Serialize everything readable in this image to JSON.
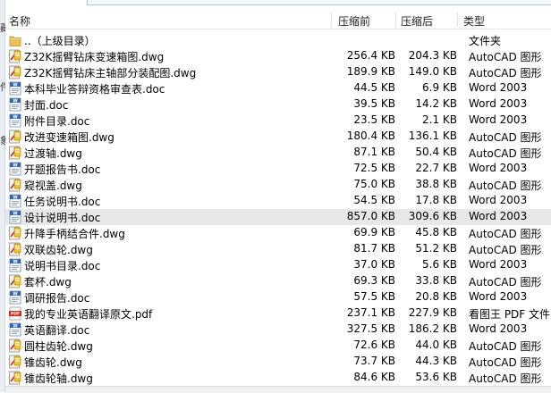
{
  "left_pane": {
    "fragments": [
      "藏",
      "件",
      "象"
    ]
  },
  "header": {
    "name": "名称",
    "compressed": "压缩前",
    "after": "压缩后",
    "type": "类型"
  },
  "files": [
    {
      "name": "..（上级目录）",
      "size": "",
      "packed": "",
      "type": "文件夹",
      "icon": "folder-up-icon"
    },
    {
      "name": "Z32K摇臂钻床变速箱图.dwg",
      "size": "256.4 KB",
      "packed": "204.3 KB",
      "type": "AutoCAD 图形",
      "icon": "dwg-file-icon"
    },
    {
      "name": "Z32K摇臂钻床主轴部分装配图.dwg",
      "size": "189.9 KB",
      "packed": "149.0 KB",
      "type": "AutoCAD 图形",
      "icon": "dwg-file-icon"
    },
    {
      "name": "本科毕业答辩资格审查表.doc",
      "size": "44.5 KB",
      "packed": "6.9 KB",
      "type": "Word 2003",
      "icon": "word-file-icon"
    },
    {
      "name": "封面.doc",
      "size": "39.5 KB",
      "packed": "14.2 KB",
      "type": "Word 2003",
      "icon": "word-file-icon"
    },
    {
      "name": "附件目录.doc",
      "size": "23.5 KB",
      "packed": "2.1 KB",
      "type": "Word 2003",
      "icon": "word-file-icon"
    },
    {
      "name": "改进变速箱图.dwg",
      "size": "180.4 KB",
      "packed": "136.1 KB",
      "type": "AutoCAD 图形",
      "icon": "dwg-file-icon"
    },
    {
      "name": "过渡轴.dwg",
      "size": "87.1 KB",
      "packed": "50.4 KB",
      "type": "AutoCAD 图形",
      "icon": "dwg-file-icon"
    },
    {
      "name": "开题报告书.doc",
      "size": "72.5 KB",
      "packed": "22.7 KB",
      "type": "Word 2003",
      "icon": "word-file-icon"
    },
    {
      "name": "窥视盖.dwg",
      "size": "75.0 KB",
      "packed": "38.8 KB",
      "type": "AutoCAD 图形",
      "icon": "dwg-file-icon"
    },
    {
      "name": "任务说明书.doc",
      "size": "54.5 KB",
      "packed": "17.8 KB",
      "type": "Word 2003",
      "icon": "word-file-icon"
    },
    {
      "name": "设计说明书.doc",
      "size": "857.0 KB",
      "packed": "309.6 KB",
      "type": "Word 2003",
      "icon": "word-file-icon",
      "selected": true
    },
    {
      "name": "升降手柄结合件.dwg",
      "size": "69.9 KB",
      "packed": "45.8 KB",
      "type": "AutoCAD 图形",
      "icon": "dwg-file-icon"
    },
    {
      "name": "双联齿轮.dwg",
      "size": "81.7 KB",
      "packed": "51.2 KB",
      "type": "AutoCAD 图形",
      "icon": "dwg-file-icon"
    },
    {
      "name": "说明书目录.doc",
      "size": "37.0 KB",
      "packed": "5.6 KB",
      "type": "Word 2003",
      "icon": "word-file-icon"
    },
    {
      "name": "套杯.dwg",
      "size": "69.3 KB",
      "packed": "33.8 KB",
      "type": "AutoCAD 图形",
      "icon": "dwg-file-icon"
    },
    {
      "name": "调研报告.doc",
      "size": "57.5 KB",
      "packed": "20.8 KB",
      "type": "Word 2003",
      "icon": "word-file-icon"
    },
    {
      "name": "我的专业英语翻译原文.pdf",
      "size": "237.1 KB",
      "packed": "227.9 KB",
      "type": "看图王 PDF 文件",
      "icon": "pdf-file-icon"
    },
    {
      "name": "英语翻译.doc",
      "size": "327.5 KB",
      "packed": "186.2 KB",
      "type": "Word 2003",
      "icon": "word-file-icon"
    },
    {
      "name": "圆柱齿轮.dwg",
      "size": "72.6 KB",
      "packed": "44.0 KB",
      "type": "AutoCAD 图形",
      "icon": "dwg-file-icon"
    },
    {
      "name": "锥齿轮.dwg",
      "size": "73.7 KB",
      "packed": "44.3 KB",
      "type": "AutoCAD 图形",
      "icon": "dwg-file-icon"
    },
    {
      "name": "锥齿轮轴.dwg",
      "size": "84.6 KB",
      "packed": "53.6 KB",
      "type": "AutoCAD 图形",
      "icon": "dwg-file-icon"
    }
  ]
}
